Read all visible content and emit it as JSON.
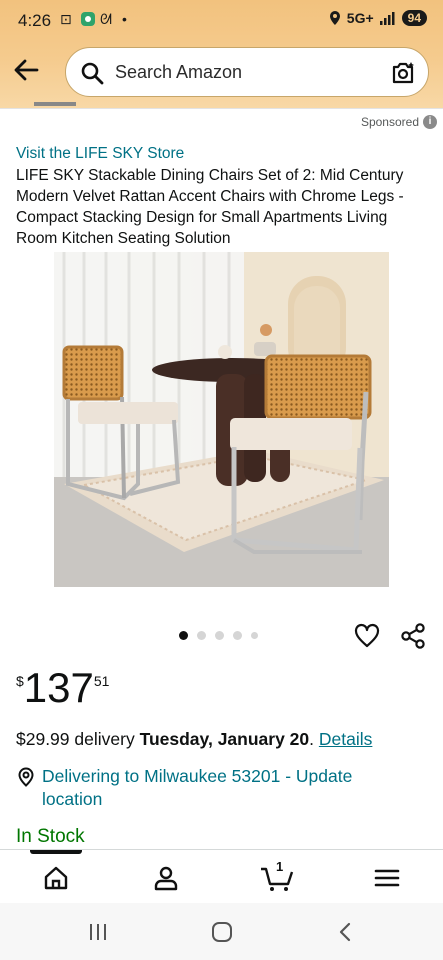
{
  "status_bar": {
    "time": "4:26",
    "network": "5G+",
    "battery": "94"
  },
  "header": {
    "search_placeholder": "Search Amazon"
  },
  "ad": {
    "sponsored_label": "Sponsored"
  },
  "product": {
    "store_link": "Visit the LIFE SKY Store",
    "title": "LIFE SKY Stackable Dining Chairs Set of 2: Mid Century Modern Velvet Rattan Accent Chairs with Chrome Legs - Compact Stacking Design for Small Apartments Living Room Kitchen Seating Solution",
    "image_count": 5,
    "active_image_index": 0,
    "price": {
      "currency": "$",
      "whole": "137",
      "fraction": "51"
    },
    "delivery": {
      "prefix": "$29.99 delivery ",
      "date": "Tuesday, January 20",
      "suffix": ". ",
      "details_link": "Details"
    },
    "location_link": "Delivering to Milwaukee 53201 - Update location",
    "stock_status": "In Stock"
  },
  "bottom_nav": {
    "cart_count": "1",
    "items": [
      "home-icon",
      "account-icon",
      "cart-icon",
      "menu-icon"
    ]
  },
  "colors": {
    "header_gradient_top": "#f2c27e",
    "link": "#007185",
    "in_stock": "#007600",
    "text": "#0f1111"
  }
}
